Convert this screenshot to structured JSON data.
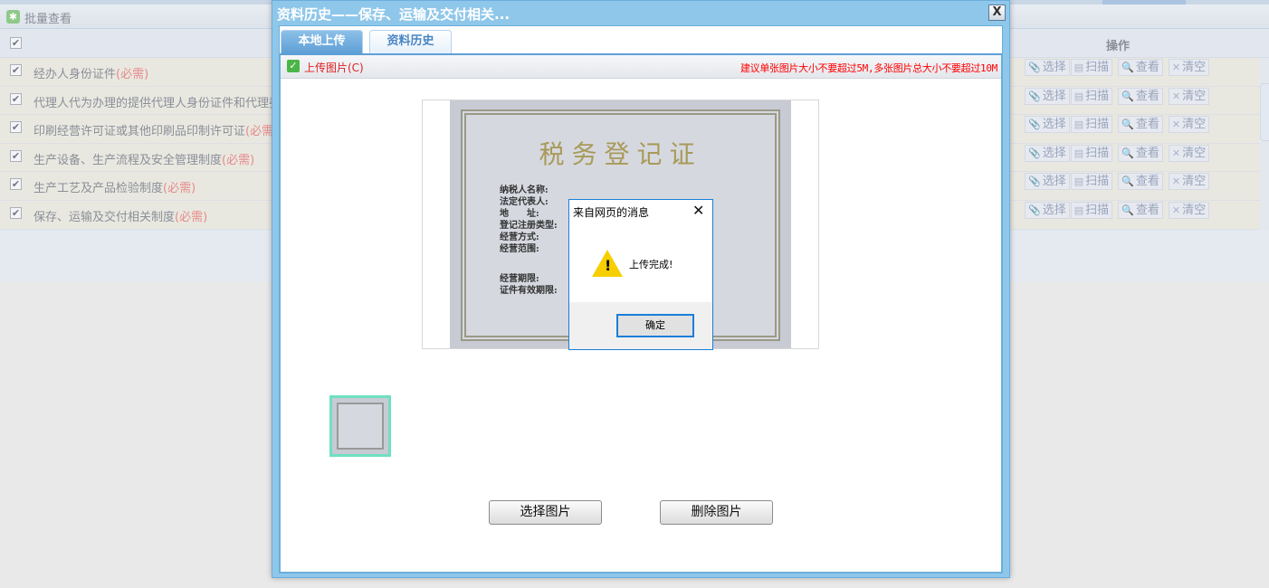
{
  "panel": {
    "title": "批量查看",
    "op_header": "操作",
    "rows": [
      {
        "label": "经办人身份证件",
        "req": "(必需)"
      },
      {
        "label": "代理人代为办理的提供代理人身份证件和代理委托",
        "req": ""
      },
      {
        "label": "印刷经营许可证或其他印刷品印制许可证",
        "req": "(必需)"
      },
      {
        "label": "生产设备、生产流程及安全管理制度",
        "req": "(必需)"
      },
      {
        "label": "生产工艺及产品检验制度",
        "req": "(必需)"
      },
      {
        "label": "保存、运输及交付相关制度",
        "req": "(必需)"
      }
    ],
    "ops": {
      "select": "选择",
      "scan": "扫描",
      "view": "查看",
      "clear": "清空"
    }
  },
  "dialog": {
    "title": "资料历史——保存、运输及交付相关...",
    "close": "X",
    "tabs": [
      {
        "label": "本地上传",
        "active": true
      },
      {
        "label": "资料历史",
        "active": false
      }
    ],
    "upload_label": "上传图片(C)",
    "tip": "建议单张图片大小不要超过5M,多张图片总大小不要超过10M",
    "image": {
      "heading": "税务登记证",
      "fields": [
        "纳税人名称:",
        "法定代表人:",
        "地　　址:",
        "登记注册类型:",
        "经营方式:",
        "经营范围:",
        "经营期限:",
        "证件有效期限:"
      ]
    },
    "buttons": {
      "select": "选择图片",
      "delete": "删除图片"
    }
  },
  "alert": {
    "title": "来自网页的消息",
    "message": "上传完成!",
    "ok": "确定",
    "icon": "warning-icon"
  }
}
